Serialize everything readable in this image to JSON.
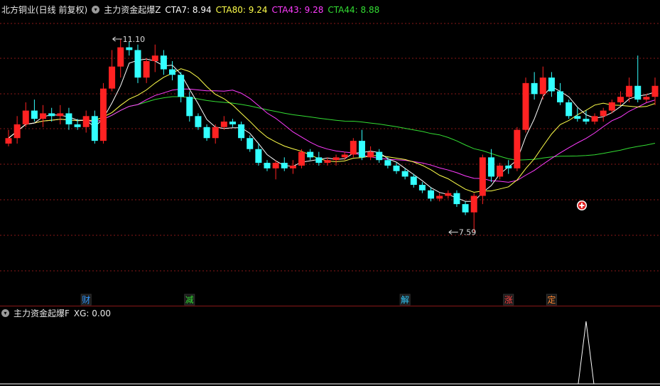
{
  "header": {
    "stock": "北方铜业(日线 前复权)",
    "indicator_name": "主力资金起爆Z",
    "cta7": {
      "label": "CTA7:",
      "value": "8.94",
      "color": "#ffffff"
    },
    "cta80": {
      "label": "CTA80:",
      "value": "9.24",
      "color": "#ffff4a"
    },
    "cta43": {
      "label": "CTA43:",
      "value": "9.28",
      "color": "#ff3cff"
    },
    "cta44": {
      "label": "CTA44:",
      "value": "8.88",
      "color": "#33dd33"
    }
  },
  "sub_header": {
    "name": "主力资金起爆F",
    "xg_label": "XG:",
    "xg_value": "0.00"
  },
  "colors": {
    "up": "#ff2222",
    "down": "#33ffff",
    "grid": "#8a1818",
    "background": "#000000"
  },
  "chart_data": [
    {
      "type": "candlestick",
      "ylim": [
        6.9,
        11.5
      ],
      "annotations": [
        {
          "text": "11.10",
          "bar": 12,
          "value": 11.1
        },
        {
          "text": "7.59",
          "bar": 51,
          "value": 7.59
        }
      ],
      "markers": [
        {
          "text": "财",
          "bar": 9,
          "color": "#3399ff"
        },
        {
          "text": "减",
          "bar": 21,
          "color": "#33dd33"
        },
        {
          "text": "解",
          "bar": 46,
          "color": "#33ccff"
        },
        {
          "text": "涨",
          "bar": 58,
          "color": "#ff4444"
        },
        {
          "text": "定",
          "bar": 63,
          "color": "#ff8833"
        }
      ],
      "series": [
        {
          "name": "OHLC",
          "ohlc": [
            [
              9.2,
              9.45,
              9.15,
              9.3
            ],
            [
              9.3,
              9.7,
              9.2,
              9.55
            ],
            [
              9.55,
              9.95,
              9.5,
              9.8
            ],
            [
              9.8,
              10.0,
              9.6,
              9.65
            ],
            [
              9.65,
              9.9,
              9.5,
              9.75
            ],
            [
              9.75,
              9.85,
              9.6,
              9.7
            ],
            [
              9.7,
              9.9,
              9.55,
              9.75
            ],
            [
              9.75,
              9.85,
              9.45,
              9.55
            ],
            [
              9.55,
              9.65,
              9.45,
              9.5
            ],
            [
              9.5,
              9.8,
              9.4,
              9.7
            ],
            [
              9.7,
              9.8,
              9.2,
              9.25
            ],
            [
              9.25,
              10.3,
              9.2,
              10.2
            ],
            [
              10.2,
              10.9,
              10.15,
              10.6
            ],
            [
              10.6,
              11.1,
              10.4,
              10.95
            ],
            [
              10.95,
              11.05,
              10.8,
              10.9
            ],
            [
              10.9,
              11.0,
              10.3,
              10.4
            ],
            [
              10.4,
              10.75,
              10.3,
              10.7
            ],
            [
              10.7,
              11.0,
              10.5,
              10.8
            ],
            [
              10.8,
              10.9,
              10.45,
              10.55
            ],
            [
              10.55,
              10.7,
              10.35,
              10.45
            ],
            [
              10.45,
              10.5,
              9.95,
              10.05
            ],
            [
              10.05,
              10.15,
              9.6,
              9.7
            ],
            [
              9.7,
              9.75,
              9.45,
              9.5
            ],
            [
              9.5,
              9.55,
              9.25,
              9.3
            ],
            [
              9.3,
              9.55,
              9.2,
              9.5
            ],
            [
              9.5,
              9.7,
              9.45,
              9.6
            ],
            [
              9.6,
              9.65,
              9.5,
              9.55
            ],
            [
              9.55,
              9.6,
              9.25,
              9.3
            ],
            [
              9.3,
              9.35,
              9.05,
              9.1
            ],
            [
              9.1,
              9.2,
              8.8,
              8.85
            ],
            [
              8.85,
              8.9,
              8.7,
              8.75
            ],
            [
              8.75,
              8.9,
              8.55,
              8.85
            ],
            [
              8.85,
              8.95,
              8.7,
              8.75
            ],
            [
              8.75,
              8.9,
              8.65,
              8.8
            ],
            [
              8.8,
              9.1,
              8.75,
              9.05
            ],
            [
              9.05,
              9.1,
              8.9,
              8.95
            ],
            [
              8.95,
              9.05,
              8.8,
              8.85
            ],
            [
              8.85,
              8.95,
              8.8,
              8.9
            ],
            [
              8.9,
              9.0,
              8.8,
              8.95
            ],
            [
              8.95,
              9.05,
              8.9,
              9.0
            ],
            [
              9.0,
              9.3,
              8.95,
              9.25
            ],
            [
              9.25,
              9.45,
              8.9,
              8.95
            ],
            [
              8.95,
              9.15,
              8.9,
              9.05
            ],
            [
              9.05,
              9.1,
              8.85,
              8.9
            ],
            [
              8.9,
              8.95,
              8.75,
              8.8
            ],
            [
              8.8,
              8.85,
              8.65,
              8.7
            ],
            [
              8.7,
              8.75,
              8.55,
              8.6
            ],
            [
              8.6,
              8.65,
              8.4,
              8.45
            ],
            [
              8.45,
              8.5,
              8.3,
              8.35
            ],
            [
              8.35,
              8.4,
              8.15,
              8.2
            ],
            [
              8.2,
              8.3,
              8.15,
              8.25
            ],
            [
              8.25,
              8.35,
              8.2,
              8.3
            ],
            [
              8.3,
              8.35,
              8.05,
              8.1
            ],
            [
              8.1,
              8.15,
              7.9,
              7.95
            ],
            [
              7.95,
              8.3,
              7.59,
              8.25
            ],
            [
              8.25,
              9.0,
              8.1,
              8.95
            ],
            [
              8.95,
              9.1,
              8.5,
              8.6
            ],
            [
              8.6,
              8.85,
              8.55,
              8.8
            ],
            [
              8.8,
              8.9,
              8.65,
              8.75
            ],
            [
              8.75,
              9.5,
              8.7,
              9.45
            ],
            [
              9.45,
              10.4,
              9.4,
              10.3
            ],
            [
              10.3,
              10.5,
              10.0,
              10.1
            ],
            [
              10.1,
              10.6,
              10.0,
              10.4
            ],
            [
              10.4,
              10.5,
              10.05,
              10.15
            ],
            [
              10.15,
              10.3,
              9.9,
              9.95
            ],
            [
              9.95,
              10.0,
              9.65,
              9.7
            ],
            [
              9.7,
              9.85,
              9.6,
              9.65
            ],
            [
              9.65,
              9.8,
              9.55,
              9.6
            ],
            [
              9.6,
              9.75,
              9.55,
              9.7
            ],
            [
              9.7,
              9.85,
              9.6,
              9.8
            ],
            [
              9.8,
              10.0,
              9.75,
              9.95
            ],
            [
              9.95,
              10.15,
              9.9,
              10.05
            ],
            [
              10.05,
              10.4,
              9.95,
              10.25
            ],
            [
              10.25,
              10.8,
              9.95,
              10.0
            ],
            [
              10.0,
              10.1,
              9.95,
              10.05
            ],
            [
              10.05,
              10.4,
              9.9,
              10.25
            ]
          ]
        },
        {
          "name": "CTA7",
          "color": "#ffffff"
        },
        {
          "name": "CTA80",
          "color": "#ffff4a"
        },
        {
          "name": "CTA43",
          "color": "#ff3cff"
        },
        {
          "name": "CTA44",
          "color": "#33dd33"
        }
      ]
    },
    {
      "type": "line",
      "series": [
        {
          "name": "XG",
          "color": "#ffffff",
          "spike_bar": 67,
          "value": 0.0
        }
      ]
    }
  ]
}
